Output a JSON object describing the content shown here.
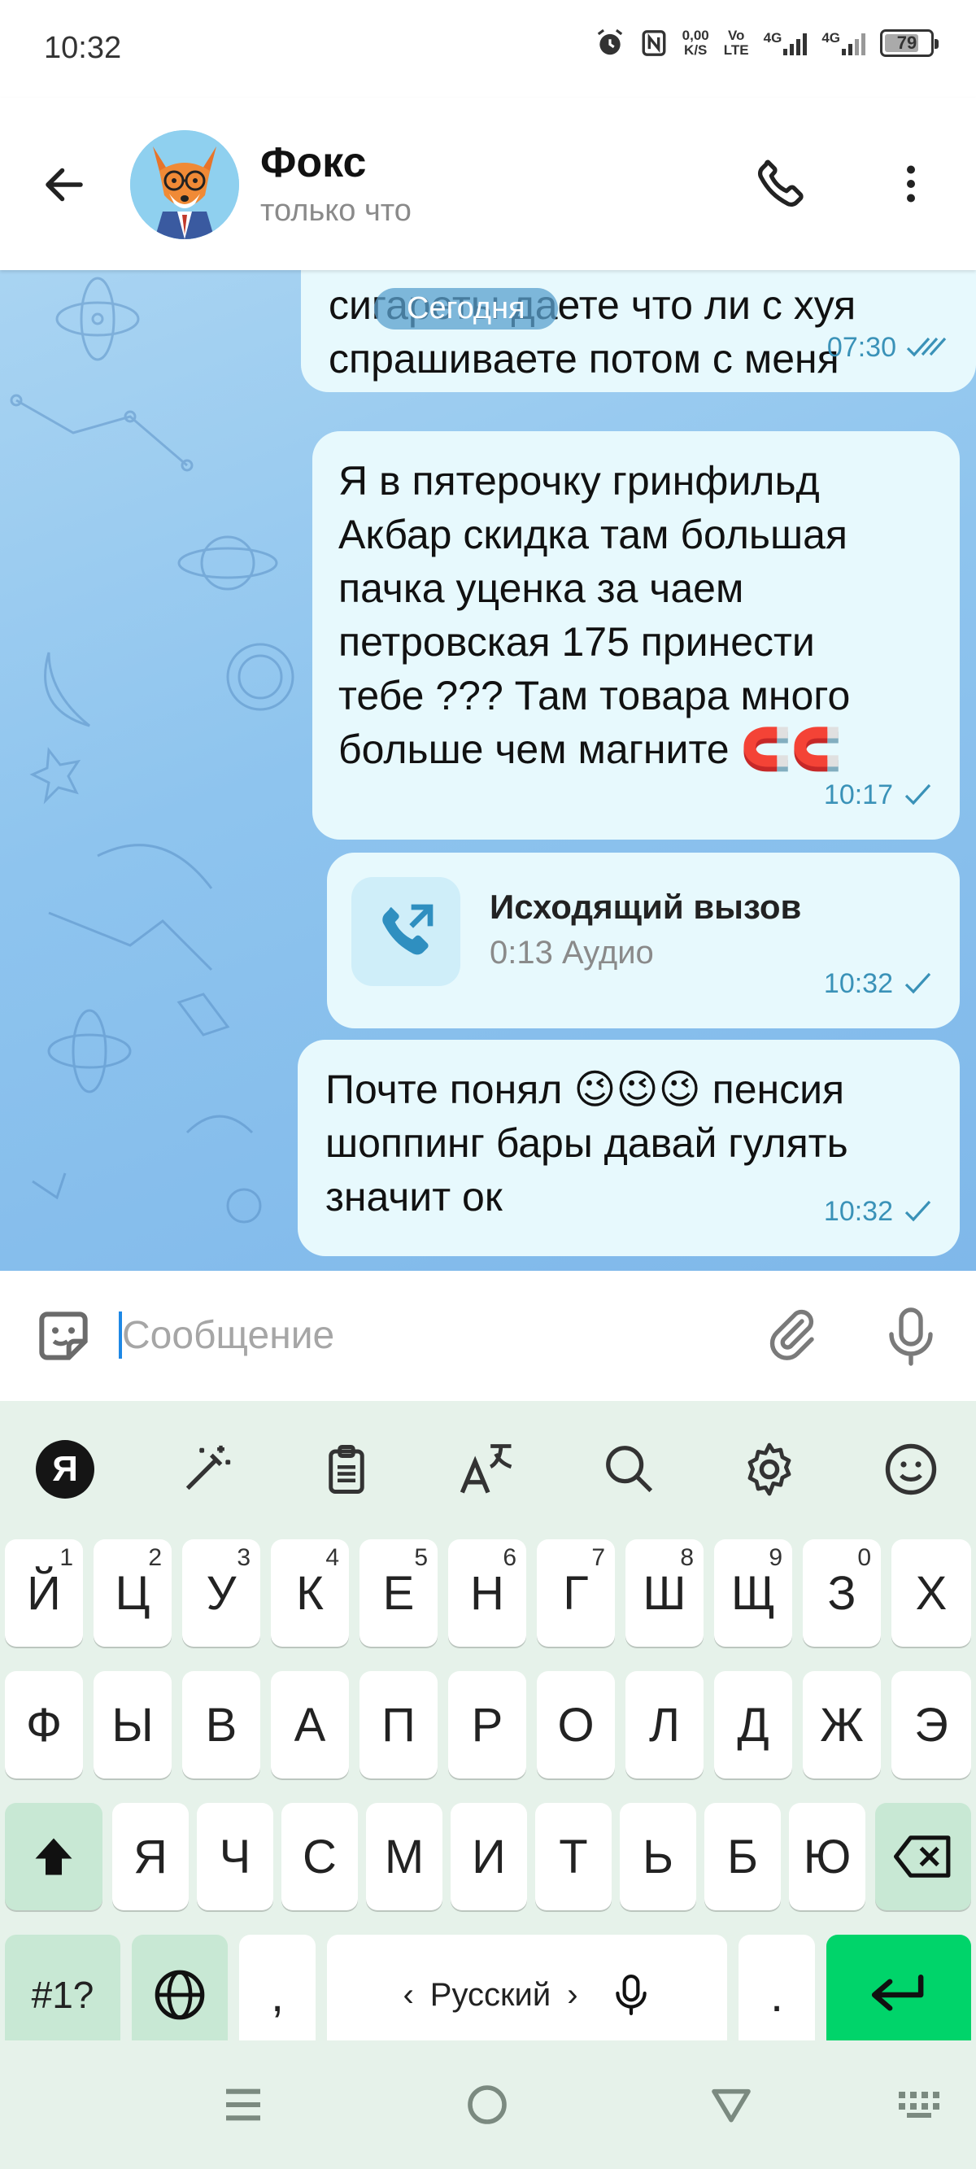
{
  "status_bar": {
    "time": "10:32",
    "net_speed_value": "0,00",
    "net_speed_unit": "K/S",
    "volte_top": "Vo",
    "volte_bottom": "LTE",
    "net1": "4G",
    "net2": "4G",
    "battery": "79",
    "icons": [
      "alarm-icon",
      "nfc-icon",
      "signal-icon",
      "battery-icon"
    ]
  },
  "header": {
    "contact_name": "Фокс",
    "contact_status": "только что",
    "icons": [
      "back-arrow-icon",
      "phone-icon",
      "more-vert-icon"
    ]
  },
  "chat": {
    "date_label": "Сегодня",
    "messages": [
      {
        "text": "сигареты даете что ли с хуя\nспрашиваете потом с меня",
        "time": "07:30",
        "status": "read"
      },
      {
        "text": "Я в пятерочку гринфильд\nАкбар скидка там большая\nпачка уценка за чаем\nпетровская 175 принести\nтебе ??? Там товара много\nбольше чем магните 🧲🧲",
        "time": "10:17",
        "status": "sent"
      },
      {
        "type": "call",
        "title": "Исходящий вызов",
        "subtitle": "0:13 Аудио",
        "time": "10:32",
        "status": "sent"
      },
      {
        "text": "Почте понял 😉😉😉 пенсия\nшоппинг бары давай гулять\nзначит ок",
        "time": "10:32",
        "status": "sent"
      }
    ]
  },
  "input": {
    "placeholder": "Сообщение",
    "value": ""
  },
  "keyboard": {
    "toolbar": [
      "yandex-logo",
      "magic-wand-icon",
      "clipboard-icon",
      "translate-icon",
      "search-icon",
      "settings-icon",
      "emoji-icon"
    ],
    "ya_label": "Я",
    "row1": [
      {
        "k": "Й",
        "h": "1"
      },
      {
        "k": "Ц",
        "h": "2"
      },
      {
        "k": "У",
        "h": "3"
      },
      {
        "k": "К",
        "h": "4"
      },
      {
        "k": "Е",
        "h": "5"
      },
      {
        "k": "Н",
        "h": "6"
      },
      {
        "k": "Г",
        "h": "7"
      },
      {
        "k": "Ш",
        "h": "8"
      },
      {
        "k": "Щ",
        "h": "9"
      },
      {
        "k": "З",
        "h": "0"
      },
      {
        "k": "Х",
        "h": ""
      }
    ],
    "row2": [
      "Ф",
      "Ы",
      "В",
      "А",
      "П",
      "Р",
      "О",
      "Л",
      "Д",
      "Ж",
      "Э"
    ],
    "row3": [
      "Я",
      "Ч",
      "С",
      "М",
      "И",
      "Т",
      "Ь",
      "Б",
      "Ю"
    ],
    "symbols_label": "#1?",
    "comma_label": ",",
    "space_label": "Русский",
    "space_left": "‹",
    "space_right": "›",
    "period_label": "."
  },
  "colors": {
    "bubble": "#e7f9fd",
    "accent": "#3a92b8",
    "enter": "#00d46a",
    "keyboard_bg": "#e6f2ea"
  }
}
